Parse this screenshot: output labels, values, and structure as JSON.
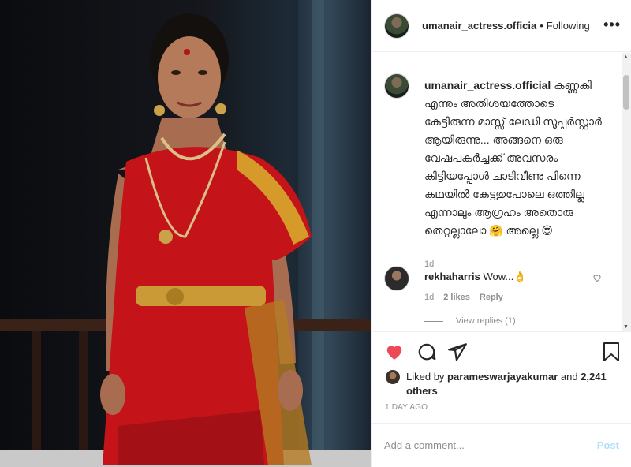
{
  "photo": {
    "alt_icon": "portrait-photo"
  },
  "header": {
    "username": "umanair_actress.officia",
    "separator": "•",
    "follow_status": "Following",
    "more_label": "•••"
  },
  "caption": {
    "username": "umanair_actress.official",
    "text": "കണ്ണകി എന്നും അതിശയത്തോടെ കേട്ടിരുന്ന മാസ്സ് ലേഡി സൂപ്പർസ്റ്റാർ ആയിരുന്നു... അങ്ങനെ ഒരു വേഷപകർച്ചക്ക് അവസരം കിട്ടിയപ്പോൾ ചാടിവീണു പിന്നെ കഥയിൽ കേട്ടതുപോലെ ഒത്തില്ല എന്നാലും ആഗ്രഹം അതൊരു തെറ്റല്ലാലോ 🤗 അല്ലെ 😍",
    "time": "1d"
  },
  "comment": {
    "username": "rekhaharris",
    "text": "Wow...👌",
    "time": "1d",
    "likes": "2 likes",
    "reply": "Reply",
    "view_replies": "View replies (1)"
  },
  "likes": {
    "prefix": "Liked by",
    "user": "parameswarjayakumar",
    "connector": "and",
    "others": "2,241 others"
  },
  "posted_ago": "1 DAY AGO",
  "add_comment": {
    "placeholder": "Add a comment...",
    "post_label": "Post"
  },
  "colors": {
    "heart": "#ed4956",
    "post_disabled": "#b2dffc",
    "secondary_text": "#8e8e8e"
  }
}
